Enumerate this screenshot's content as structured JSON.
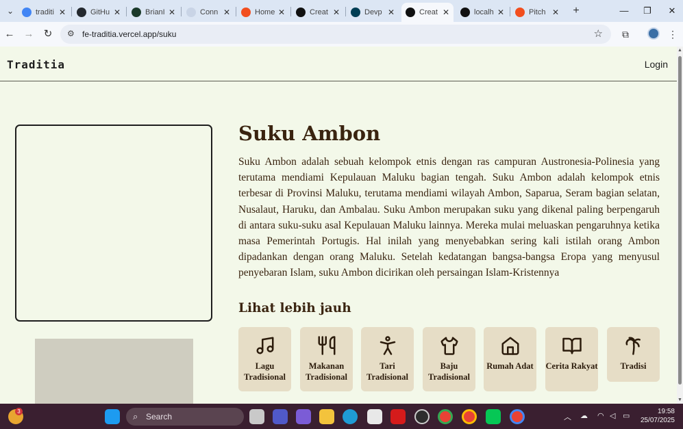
{
  "browser": {
    "tabs": [
      {
        "title": "traditi",
        "favicon": "google-icon",
        "color": "#4285f4"
      },
      {
        "title": "GitHu",
        "favicon": "github-icon",
        "color": "#24292f"
      },
      {
        "title": "BrianI",
        "favicon": "terminal-icon",
        "color": "#1b3a2a"
      },
      {
        "title": "Conn",
        "favicon": "blank-icon",
        "color": "#c9d4e6"
      },
      {
        "title": "Home",
        "favicon": "figma-icon",
        "color": "#f24e1e"
      },
      {
        "title": "Creat",
        "favicon": "vercel-icon",
        "color": "#111111"
      },
      {
        "title": "Devp",
        "favicon": "devpost-icon",
        "color": "#003e54"
      },
      {
        "title": "Creat",
        "favicon": "vercel-icon",
        "color": "#111111"
      },
      {
        "title": "localh",
        "favicon": "vercel-icon",
        "color": "#111111"
      },
      {
        "title": "Pitch",
        "favicon": "figma-icon",
        "color": "#f24e1e"
      }
    ],
    "active_tab_index": 7,
    "url": "fe-traditia.vercel.app/suku"
  },
  "site": {
    "brand": "Traditia",
    "login_label": "Login"
  },
  "article": {
    "title": "Suku Ambon",
    "description": "Suku Ambon adalah sebuah kelompok etnis dengan ras campuran Austronesia-Polinesia yang terutama mendiami Kepulauan Maluku bagian tengah. Suku Ambon adalah kelompok etnis terbesar di Provinsi Maluku, terutama mendiami wilayah Ambon, Saparua, Seram bagian selatan, Nusalaut, Haruku, dan Ambalau. Suku Ambon merupakan suku yang dikenal paling berpengaruh di antara suku-suku asal Kepulauan Maluku lainnya. Mereka mulai meluaskan pengaruhnya ketika masa Pemerintah Portugis. Hal inilah yang menyebabkan sering kali istilah orang Ambon dipadankan dengan orang Maluku. Setelah kedatangan bangsa-bangsa Eropa yang menyusul penyebaran Islam, suku Ambon dicirikan oleh persaingan Islam-Kristennya",
    "more_heading": "Lihat lebih jauh"
  },
  "categories": [
    {
      "label": "Lagu Tradisional",
      "icon": "music-note-icon"
    },
    {
      "label": "Makanan Tradisional",
      "icon": "utensils-icon"
    },
    {
      "label": "Tari Tradisional",
      "icon": "dancer-icon"
    },
    {
      "label": "Baju Tradisional",
      "icon": "shirt-icon"
    },
    {
      "label": "Rumah Adat",
      "icon": "house-icon"
    },
    {
      "label": "Cerita Rakyat",
      "icon": "book-icon"
    },
    {
      "label": "Tradisi",
      "icon": "palm-tree-icon"
    }
  ],
  "taskbar": {
    "search_label": "Search",
    "widget_badge": "3",
    "time": "19:58",
    "date": "25/07/2025"
  }
}
